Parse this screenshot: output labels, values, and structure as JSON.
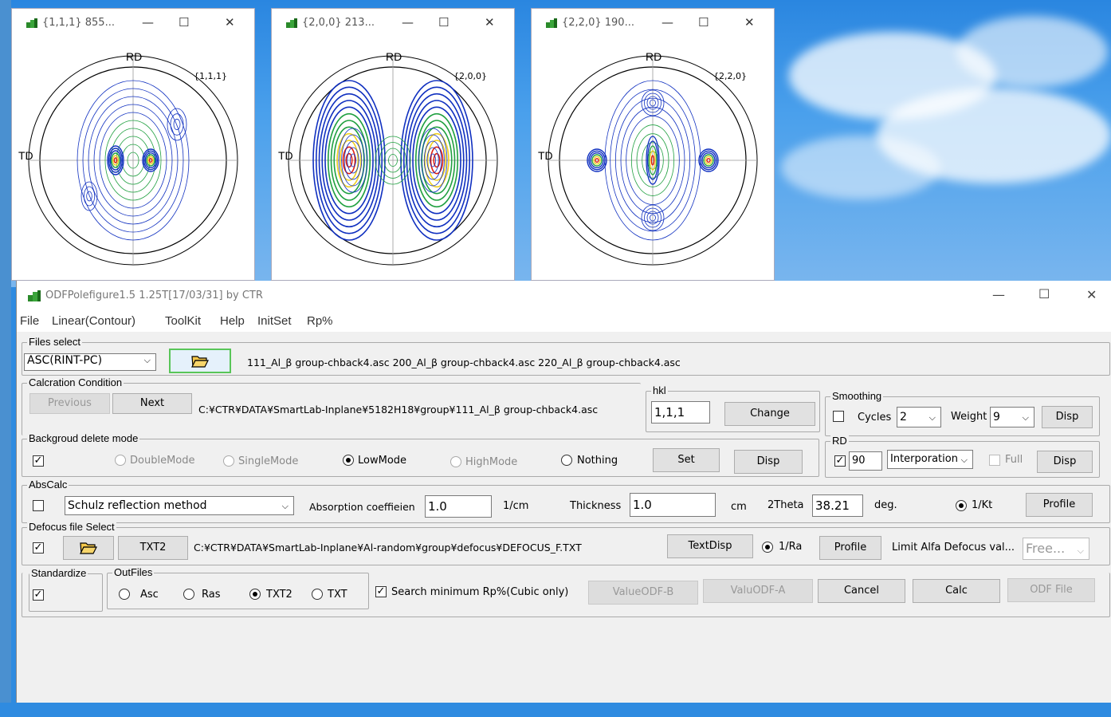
{
  "pole_windows": [
    {
      "title": "{1,1,1} 855...",
      "hkl_label": "{1,1,1}"
    },
    {
      "title": "{2,0,0} 213...",
      "hkl_label": "{2,0,0}"
    },
    {
      "title": "{2,2,0} 190...",
      "hkl_label": "{2,2,0}"
    }
  ],
  "axis_labels": {
    "rd": "RD",
    "td": "TD"
  },
  "window_buttons": {
    "minimize": "—",
    "maximize": "☐",
    "close": "✕"
  },
  "main": {
    "title": "ODFPolefigure1.5 1.25T[17/03/31] by CTR",
    "menu": [
      "File",
      "Linear(Contour)",
      "ToolKit",
      "Help",
      "InitSet",
      "Rp%"
    ],
    "files_select": {
      "label": "Files select",
      "format": "ASC(RINT-PC)",
      "files": "111_Al_β group-chback4.asc 200_Al_β group-chback4.asc 220_Al_β group-chback4.asc"
    },
    "calc_condition": {
      "label": "Calcration Condition",
      "previous": "Previous",
      "next": "Next",
      "path": "C:¥CTR¥DATA¥SmartLab-Inplane¥5182H18¥group¥111_Al_β group-chback4.asc"
    },
    "hkl": {
      "label": "hkl",
      "value": "1,1,1",
      "change": "Change"
    },
    "smoothing": {
      "label": "Smoothing",
      "cycles_label": "Cycles",
      "cycles": "2",
      "weight_label": "Weight",
      "weight": "9",
      "disp": "Disp"
    },
    "background": {
      "label": "Backgroud delete mode",
      "double": "DoubleMode",
      "single": "SingleMode",
      "low": "LowMode",
      "high": "HighMode",
      "nothing": "Nothing",
      "set": "Set",
      "disp": "Disp"
    },
    "rd": {
      "label": "RD",
      "value": "90",
      "interp": "Interporation",
      "full": "Full",
      "disp": "Disp"
    },
    "abscalc": {
      "label": "AbsCalc",
      "method": "Schulz reflection method",
      "abs_label": "Absorption coeffieien",
      "abs_value": "1.0",
      "abs_unit": "1/cm",
      "thick_label": "Thickness",
      "thick_value": "1.0",
      "thick_unit": "cm",
      "theta_label": "2Theta",
      "theta_value": "38.21",
      "theta_unit": "deg.",
      "kt": "1/Kt",
      "profile": "Profile"
    },
    "defocus": {
      "label": "Defocus file Select",
      "txt2": "TXT2",
      "path": "C:¥CTR¥DATA¥SmartLab-Inplane¥Al-random¥group¥defocus¥DEFOCUS_F.TXT",
      "textdisp": "TextDisp",
      "ra": "1/Ra",
      "profile": "Profile",
      "limit_label": "Limit Alfa Defocus val...",
      "limit_value": "Free..."
    },
    "standardize": {
      "label": "Standardize"
    },
    "outfiles": {
      "label": "OutFiles",
      "asc": "Asc",
      "ras": "Ras",
      "txt2": "TXT2",
      "txt": "TXT"
    },
    "search": "Search minimum Rp%(Cubic only)",
    "buttons": {
      "valueodf_b": "ValueODF-B",
      "valuodf_a": "ValuODF-A",
      "cancel": "Cancel",
      "calc": "Calc",
      "odf_file": "ODF File"
    }
  }
}
